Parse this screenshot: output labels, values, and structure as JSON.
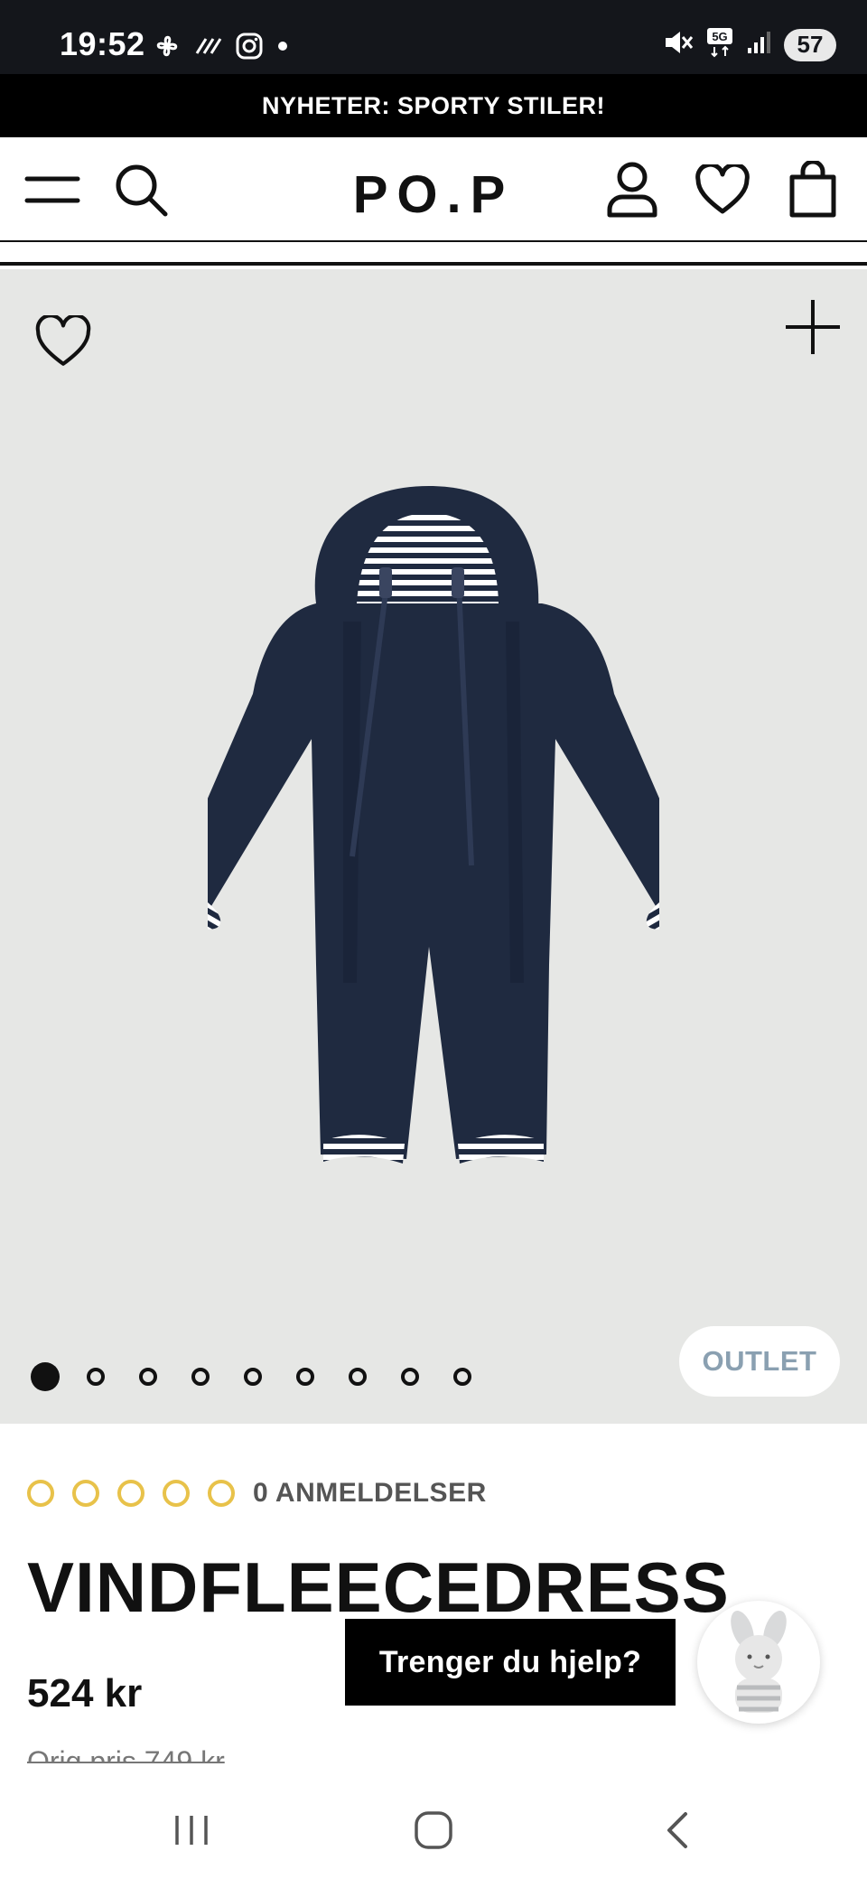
{
  "status_bar": {
    "time": "19:52",
    "battery": "57",
    "icons": [
      "pinwheel-icon",
      "signal-lines-icon",
      "instagram-icon",
      "dot-icon",
      "mute-icon",
      "5g-icon",
      "signal-bars-icon"
    ]
  },
  "promo": {
    "text": "NYHETER: SPORTY STILER!"
  },
  "header": {
    "logo": "PO.P",
    "icons": [
      "menu-icon",
      "search-icon",
      "account-icon",
      "wishlist-icon",
      "bag-icon"
    ]
  },
  "gallery": {
    "image_count": 9,
    "active_index": 0,
    "badge": "OUTLET",
    "colors": {
      "background": "#e6e7e5",
      "garment": "#1f2a40",
      "stripe": "#ffffff"
    }
  },
  "product": {
    "rating_stars": 5,
    "rating_value": 0,
    "reviews_label": "0 ANMELDELSER",
    "title": "VINDFLEECEDRESS",
    "price": "524 kr",
    "original_price": "Orig.pris 749 kr"
  },
  "help": {
    "label": "Trenger du hjelp?"
  },
  "nav": {
    "icons": [
      "recent-apps-icon",
      "home-icon",
      "back-icon"
    ]
  },
  "colors": {
    "accent": "#000000",
    "star": "#e8c24a",
    "badge_text": "#8aa0b1"
  }
}
